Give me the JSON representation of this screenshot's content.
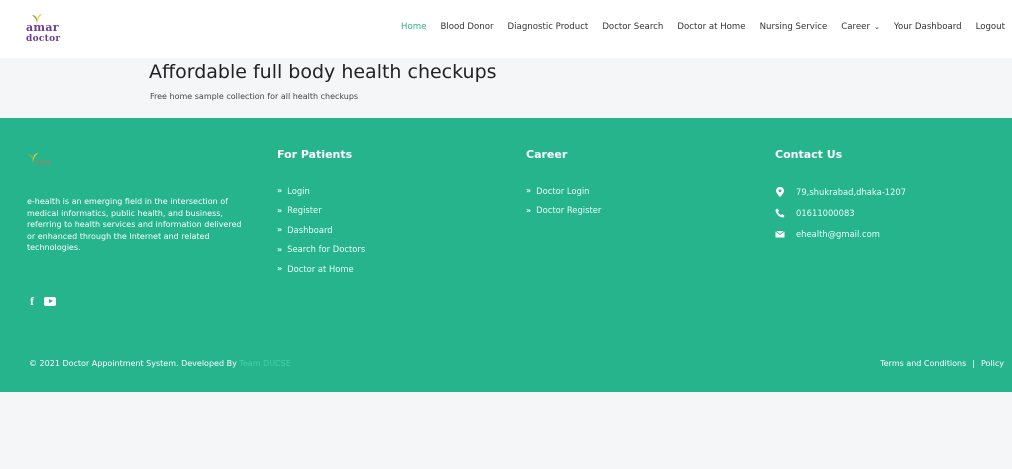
{
  "header": {
    "logo_text_1": "amar",
    "logo_text_2": "doctor",
    "nav": [
      {
        "label": "Home",
        "active": true
      },
      {
        "label": "Blood Donor"
      },
      {
        "label": "Diagnostic Product"
      },
      {
        "label": "Doctor Search"
      },
      {
        "label": "Doctor at Home"
      },
      {
        "label": "Nursing Service"
      },
      {
        "label": "Career"
      },
      {
        "label": "Your Dashboard"
      },
      {
        "label": "Logout"
      }
    ],
    "career_caret": "chevron-down-icon"
  },
  "banner": {
    "title": "Affordable full body health checkups",
    "subtitle": "Free home sample collection for all health checkups"
  },
  "footer": {
    "about": "e-health is an emerging field in the intersection of medical informatics, public health, and business, referring to health services and information delivered or enhanced through the Internet and related technologies.",
    "social": [
      "facebook-icon",
      "youtube-icon"
    ],
    "patients": {
      "title": "For Patients",
      "links": [
        "Login",
        "Register",
        "Dashboard",
        "Search for Doctors",
        "Doctor at Home"
      ]
    },
    "career": {
      "title": "Career",
      "links": [
        "Doctor Login",
        "Doctor Register"
      ]
    },
    "contact": {
      "title": "Contact Us",
      "address": "79,shukrabad,dhaka-1207",
      "phone": "01611000083",
      "email": "ehealth@gmail.com"
    },
    "copyright": "© 2021 Doctor Appointment System. Developed By",
    "developer": "Team DUCSE",
    "terms": "Terms and Conditions",
    "separator": "|",
    "policy": "Policy"
  },
  "colors": {
    "accent": "#26b48d",
    "active_nav": "#2db38b",
    "logo": "#6c3d91"
  }
}
